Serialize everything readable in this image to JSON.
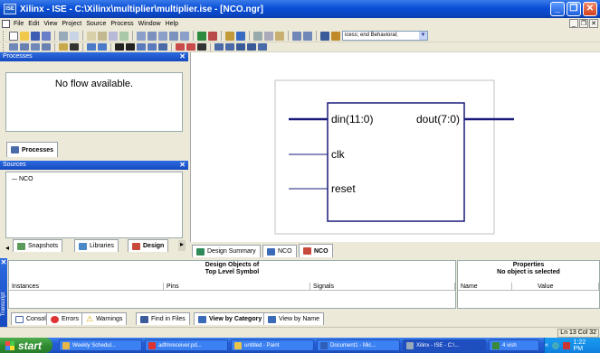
{
  "window": {
    "title": "Xilinx - ISE - C:\\Xilinx\\multiplier\\multiplier.ise - [NCO.ngr]",
    "app_icon_label": "ISE"
  },
  "menu": [
    "File",
    "Edit",
    "View",
    "Project",
    "Source",
    "Process",
    "Window",
    "Help"
  ],
  "toolbar": {
    "process_combo": "icess; end Behavioral;"
  },
  "processes": {
    "title": "Processes",
    "message": "No flow available.",
    "tab_label": "Processes"
  },
  "sources": {
    "title": "Sources",
    "items": [
      "NCO"
    ],
    "tabs": [
      "Snapshots",
      "Libraries",
      "Design"
    ]
  },
  "schematic": {
    "ports_in": [
      "din(11:0)",
      "clk",
      "reset"
    ],
    "ports_out": [
      "dout(7:0)"
    ]
  },
  "editor_tabs": [
    "Design Summary",
    "NCO",
    "NCO"
  ],
  "design_objects": {
    "title_line1": "Design Objects of",
    "title_line2": "Top Level Symbol",
    "columns": [
      "Instances",
      "Pins",
      "Signals"
    ]
  },
  "properties": {
    "title_line1": "Properties",
    "title_line2": "No object is selected",
    "columns": [
      "Name",
      "Value"
    ]
  },
  "transcript": {
    "side_label": "Transcript",
    "tabs": [
      "Console",
      "Errors",
      "Warnings",
      "Find in Files",
      "View by Category",
      "View by Name"
    ]
  },
  "status": {
    "position": "Ln 13 Col 32"
  },
  "taskbar": {
    "start_label": "start",
    "tasks": [
      "Weekly Schedul...",
      "adfmreceiver.pd...",
      "untitled - Paint",
      "Document1 - Mic...",
      "Xilinx - ISE - C:\\...",
      "4 vish"
    ],
    "clock": "1:22 PM"
  },
  "colors": {
    "title_blue": "#0a4fd6",
    "panel_blue": "#1549c0",
    "wire_navy": "#1a1a7a",
    "taskbar_blue": "#245dd7",
    "start_green": "#2f8a2f"
  }
}
